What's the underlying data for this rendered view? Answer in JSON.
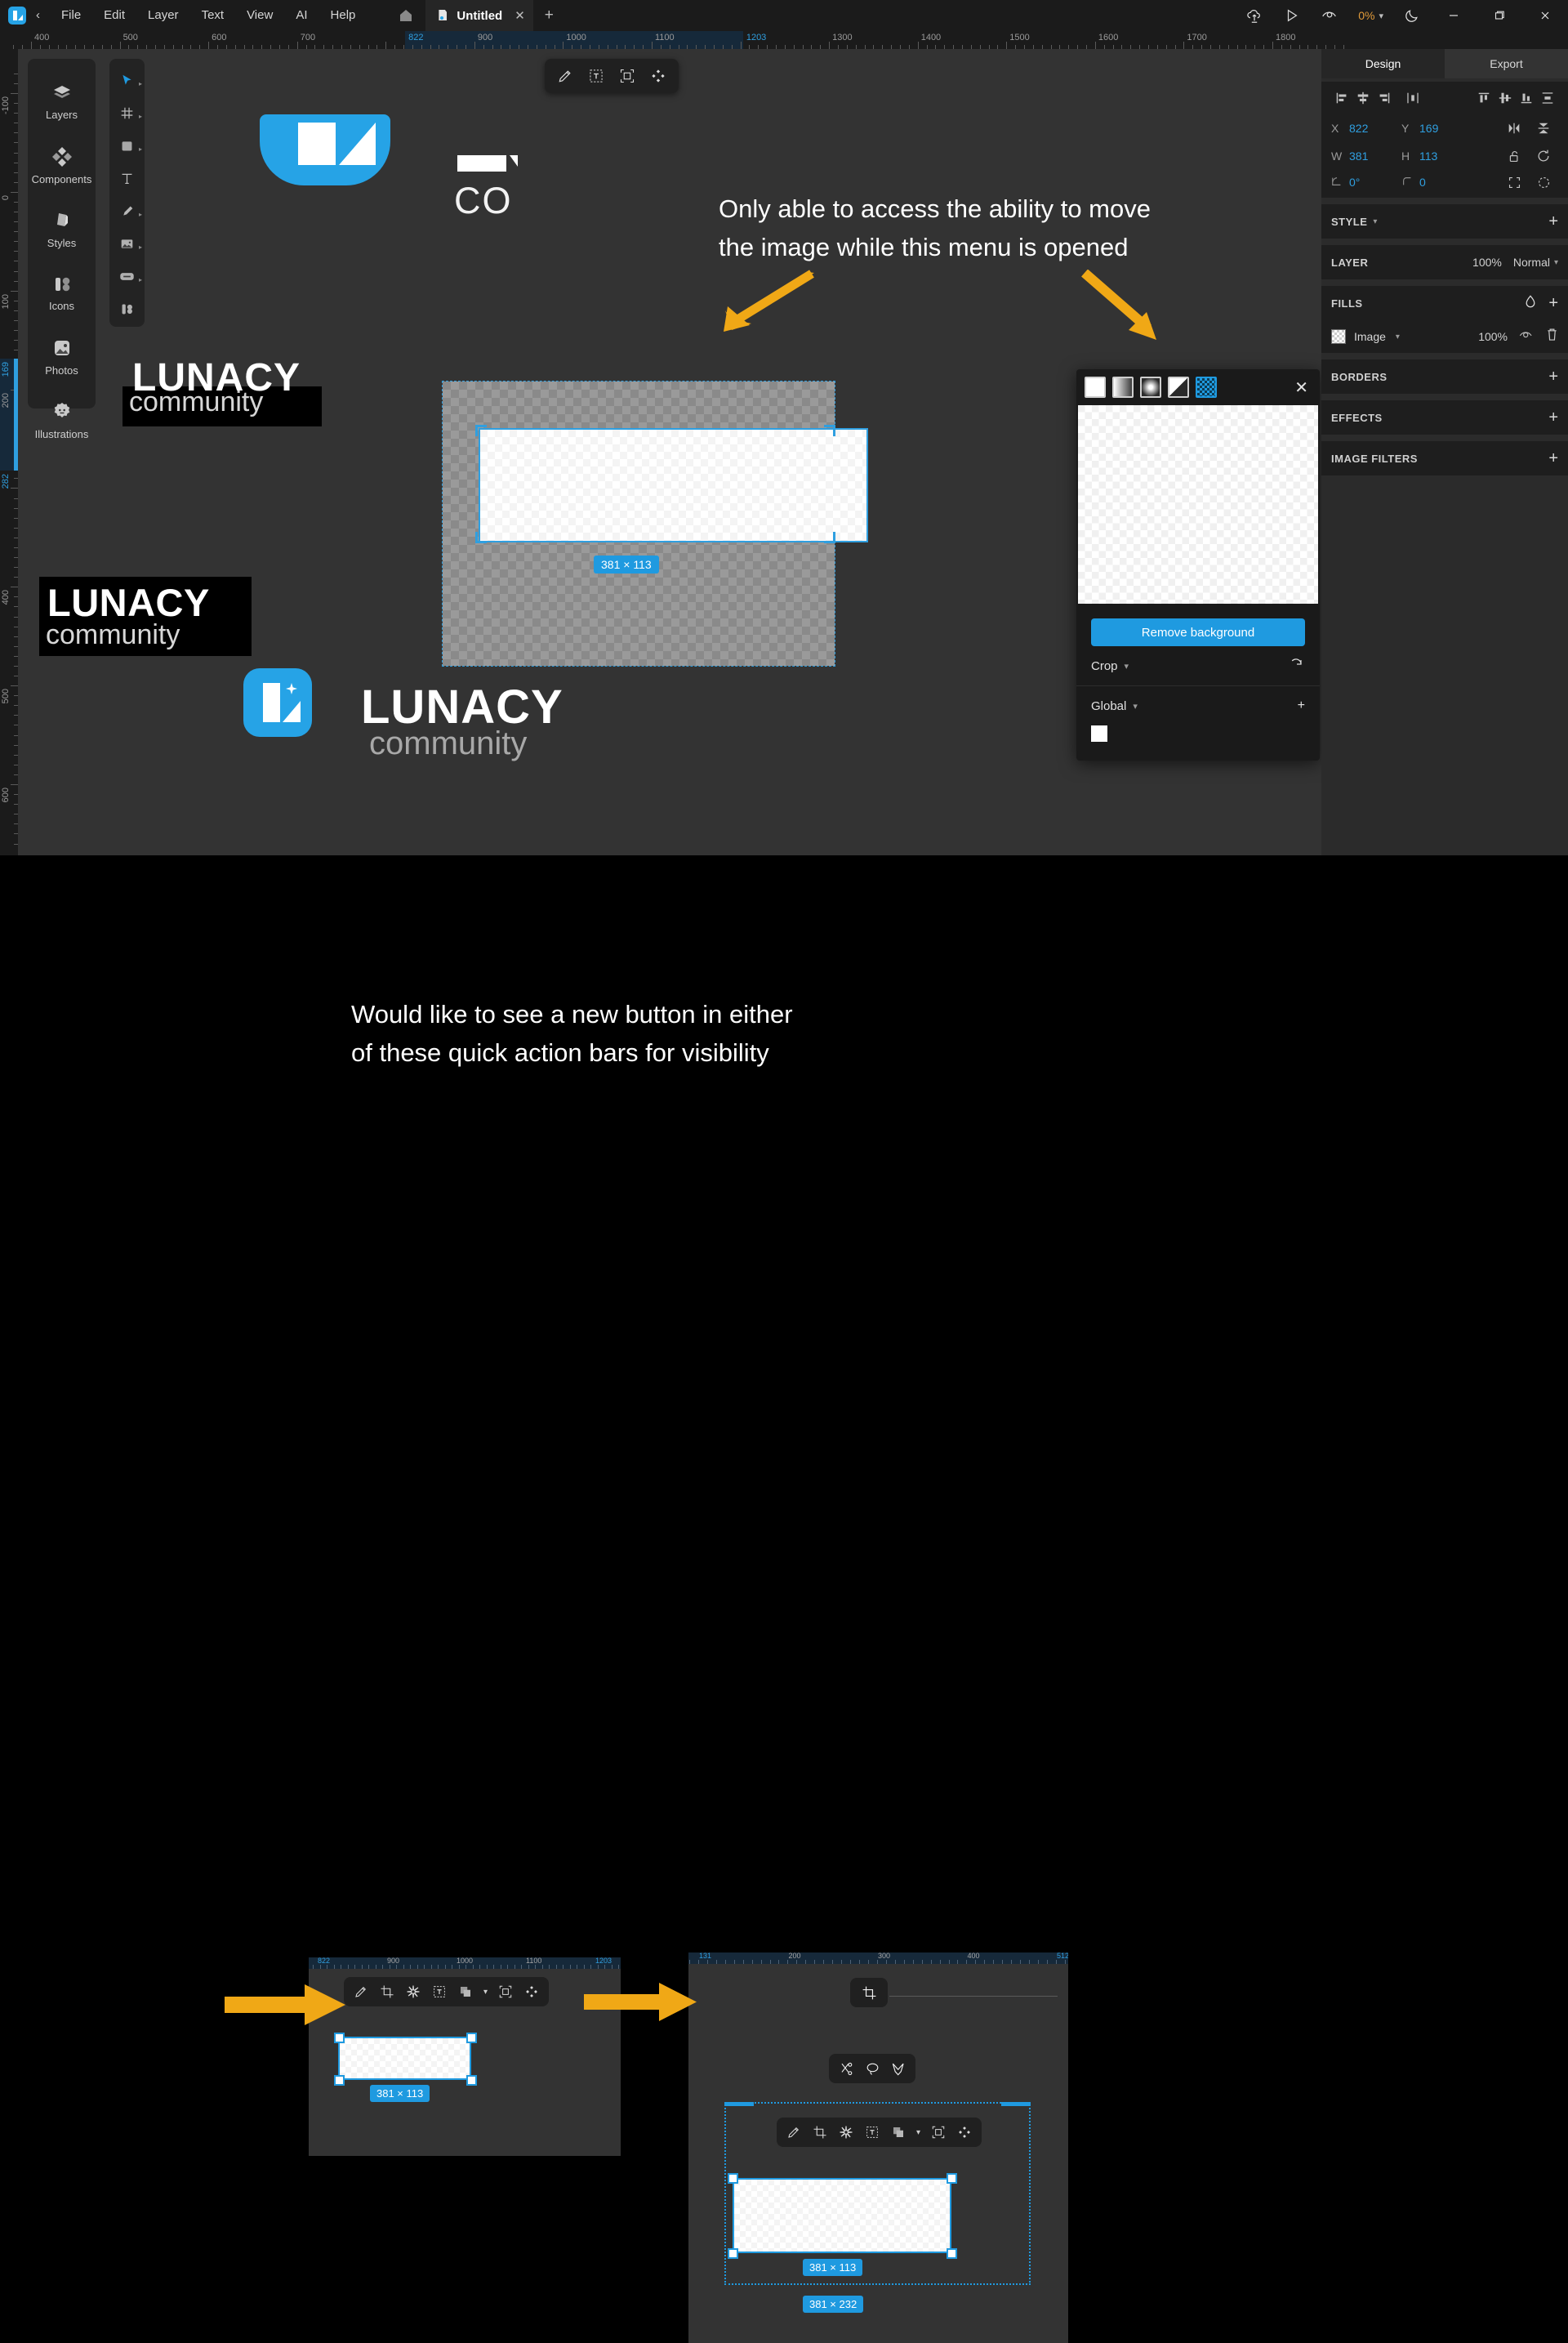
{
  "app": {
    "titlebar": {
      "logo_icon": "lunacy-logo-icon",
      "back_icon": "chevron-left-icon",
      "menus": [
        "File",
        "Edit",
        "Layer",
        "Text",
        "View",
        "AI",
        "Help"
      ],
      "home_icon": "home-icon",
      "tab": {
        "title": "Untitled",
        "close_icon": "close-icon",
        "doc_icon": "document-icon"
      },
      "new_tab_icon": "plus-icon",
      "right_icons": [
        "cloud-upload-icon",
        "play-icon",
        "preview-eye-icon"
      ],
      "zoom_value": "0%",
      "zoom_caret_icon": "chevron-down-icon",
      "theme_icon": "moon-icon",
      "window_controls": [
        "minimize-icon",
        "maximize-icon",
        "close-icon"
      ]
    },
    "ruler_h": {
      "labels": [
        "400",
        "500",
        "600",
        "700",
        "822",
        "900",
        "1000",
        "1100",
        "1203",
        "1300",
        "1400",
        "1500",
        "1600",
        "1700",
        "1800"
      ],
      "selected": [
        "822",
        "1203"
      ]
    },
    "ruler_v": {
      "labels": [
        "-100",
        "0",
        "100",
        "169",
        "200",
        "282",
        "400",
        "500",
        "600"
      ],
      "selected": [
        "169",
        "282"
      ]
    },
    "left_nav": [
      {
        "label": "Layers",
        "icon": "layers-icon"
      },
      {
        "label": "Components",
        "icon": "components-icon"
      },
      {
        "label": "Styles",
        "icon": "styles-icon"
      },
      {
        "label": "Icons",
        "icon": "icons-icon"
      },
      {
        "label": "Photos",
        "icon": "photos-icon"
      },
      {
        "label": "Illustrations",
        "icon": "illustrations-icon"
      }
    ],
    "left_tools": [
      {
        "icon": "cursor-select-icon",
        "has_submenu": true,
        "active": true
      },
      {
        "icon": "grid-frame-icon",
        "has_submenu": true,
        "active": false
      },
      {
        "icon": "rectangle-icon",
        "has_submenu": true,
        "active": false
      },
      {
        "icon": "text-tool-icon",
        "has_submenu": false,
        "active": false
      },
      {
        "icon": "pen-tool-icon",
        "has_submenu": true,
        "active": false
      },
      {
        "icon": "image-tool-icon",
        "has_submenu": true,
        "active": false
      },
      {
        "icon": "button-component-icon",
        "has_submenu": true,
        "active": false
      },
      {
        "icon": "icons-library-icon",
        "has_submenu": false,
        "active": false
      }
    ],
    "canvas_toolbar": [
      {
        "icon": "pencil-edit-icon"
      },
      {
        "icon": "text-on-path-icon"
      },
      {
        "icon": "make-component-icon"
      },
      {
        "icon": "plugins-icon"
      }
    ],
    "canvas_art": {
      "logo_tile_1": "lunacy-logo-tile",
      "text_co": "CO",
      "block1_title": "LUNACY",
      "block1_sub": "community",
      "block2_title": "LUNACY",
      "block2_sub": "community",
      "app_icon": "lunacy-app-icon",
      "lunacy_title": "LUNACY",
      "lunacy_sub": "community"
    },
    "selection": {
      "size_badge": "381 × 113"
    },
    "right_panel": {
      "tabs": [
        {
          "label": "Design",
          "active": true
        },
        {
          "label": "Export",
          "active": false
        }
      ],
      "align_icons": [
        "align-left-icon",
        "align-center-h-icon",
        "align-right-icon",
        "distribute-h-icon",
        "align-top-icon",
        "align-middle-v-icon",
        "align-bottom-icon",
        "distribute-v-icon"
      ],
      "geometry": {
        "x_label": "X",
        "x_value": "822",
        "y_label": "Y",
        "y_value": "169",
        "w_label": "W",
        "w_value": "381",
        "h_label": "H",
        "h_value": "113",
        "rotation_label": "rotation-icon",
        "rotation_value": "0°",
        "radius_label": "corner-radius-icon",
        "radius_value": "0",
        "flip_h_icon": "flip-horizontal-icon",
        "flip_v_icon": "flip-vertical-icon",
        "lock_ratio_icon": "unlock-aspect-icon",
        "reset_icon": "reset-rotation-icon",
        "fit_icon": "fit-content-icon",
        "mask_icon": "mask-icon"
      },
      "sections": [
        {
          "name": "STYLE",
          "caret": true,
          "plus": true
        },
        {
          "name": "LAYER",
          "opacity": "100%",
          "blend": "Normal",
          "caret": true
        },
        {
          "name": "FILLS",
          "plus": true,
          "color_icon": "color-picker-icon"
        },
        {
          "name": "BORDERS",
          "plus": true
        },
        {
          "name": "EFFECTS",
          "plus": true
        },
        {
          "name": "IMAGE FILTERS",
          "plus": true
        }
      ],
      "fill_row": {
        "swatch_icon": "checkerboard-swatch",
        "name": "Image",
        "caret_icon": "chevron-down-icon",
        "opacity": "100%",
        "visibility_icon": "eye-icon",
        "delete_icon": "trash-icon"
      }
    },
    "image_popup": {
      "modes": [
        "fill-mode-icon",
        "fit-mode-icon",
        "stretch-mode-icon",
        "tile-mode-icon",
        "pattern-mode-icon"
      ],
      "active_mode_index": 4,
      "close_icon": "close-icon",
      "remove_bg_label": "Remove background",
      "crop_label": "Crop",
      "crop_caret_icon": "chevron-down-icon",
      "crop_reset_icon": "reset-crop-icon",
      "global_label": "Global",
      "global_caret_icon": "chevron-down-icon",
      "global_plus_icon": "plus-icon"
    }
  },
  "annotations": {
    "top": {
      "line1": "Only able to access the ability to move",
      "line2": "the image while this menu is opened",
      "arrow_color": "#f0a816",
      "arrows": [
        "arrow-to-canvas-image",
        "arrow-to-image-menu"
      ]
    },
    "bottom": {
      "line1": "Would like to see a new button in either",
      "line2": "of these quick action bars for visibility",
      "arrow_color": "#f0a816",
      "arrows": [
        "arrow-to-left-quick-action-bar",
        "arrow-to-right-crop-button"
      ]
    }
  },
  "lower_left_panel": {
    "ruler_labels": [
      "822",
      "900",
      "1000",
      "1100",
      "1203"
    ],
    "toolbar": [
      {
        "icon": "pencil-edit-icon"
      },
      {
        "icon": "crop-icon"
      },
      {
        "icon": "adjust-icon"
      },
      {
        "icon": "text-on-path-icon"
      },
      {
        "icon": "boolean-ops-icon",
        "has_caret": true
      },
      {
        "icon": "make-component-icon"
      },
      {
        "icon": "plugins-icon"
      }
    ],
    "size_badge": "381 × 113"
  },
  "lower_right_panel": {
    "ruler_labels": [
      "131",
      "200",
      "300",
      "400",
      "512"
    ],
    "crop_button_icon": "crop-icon",
    "small_toolbar": [
      {
        "icon": "scissors-icon"
      },
      {
        "icon": "lasso-icon"
      },
      {
        "icon": "magic-wand-select-icon"
      }
    ],
    "toolbar": [
      {
        "icon": "pencil-edit-icon"
      },
      {
        "icon": "crop-icon"
      },
      {
        "icon": "adjust-icon"
      },
      {
        "icon": "text-on-path-icon"
      },
      {
        "icon": "boolean-ops-icon",
        "has_caret": true
      },
      {
        "icon": "make-component-icon"
      },
      {
        "icon": "plugins-icon"
      }
    ],
    "size_badge_inner": "381 × 113",
    "size_badge_outer": "381 × 232"
  },
  "colors": {
    "accent_blue": "#1f9ae0",
    "annotation_orange": "#f0a816",
    "panel_bg": "#2b2b2b",
    "canvas_bg": "#333333",
    "titlebar_bg": "#1b1b1b"
  }
}
